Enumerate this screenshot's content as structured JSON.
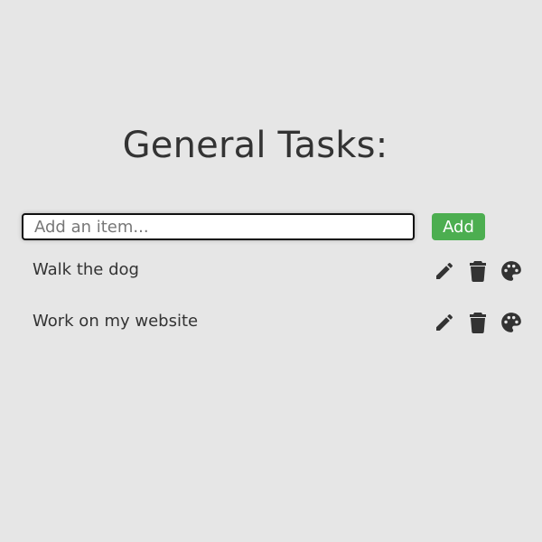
{
  "header": {
    "title": "General Tasks:"
  },
  "add_form": {
    "placeholder": "Add an item...",
    "value": "",
    "button_label": "Add"
  },
  "tasks": [
    {
      "label": "Walk the dog"
    },
    {
      "label": "Work on my website"
    }
  ],
  "icons": {
    "edit": "pencil-icon",
    "delete": "trash-icon",
    "color": "palette-icon"
  },
  "colors": {
    "background": "#e6e6e6",
    "accent": "#4cae50",
    "text": "#333333"
  }
}
